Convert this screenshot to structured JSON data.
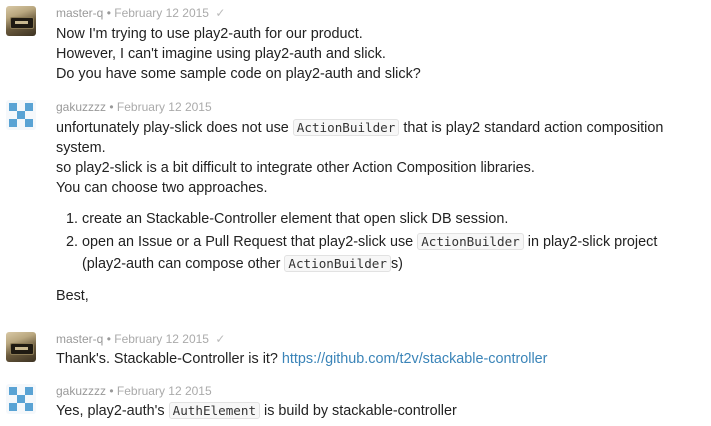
{
  "messages": [
    {
      "author": "master-q",
      "date": "February 12 2015",
      "lines": [
        "Now I'm trying to use play2-auth for our product.",
        "However, I can't imagine using play2-auth and slick.",
        "Do you have some sample code on play2-auth and slick?"
      ]
    },
    {
      "author": "gakuzzzz",
      "date": "February 12 2015",
      "p1_a": "unfortunately play-slick does not use",
      "p1_code": "ActionBuilder",
      "p1_b": "that is play2 standard action composition",
      "p1_c": "system.",
      "p2": "so play2-slick is a bit difficult to integrate other Action Composition libraries.",
      "p3": "You can choose two approaches.",
      "li1": "create an Stackable-Controller element that open slick DB session.",
      "li2_a": "open an Issue or a Pull Request that play2-slick use",
      "li2_code": "ActionBuilder",
      "li2_b": "in play2-slick project",
      "li2_c": "(play2-auth can compose other",
      "li2_code2": "ActionBuilder",
      "li2_d": "s)",
      "closing": "Best,"
    },
    {
      "author": "master-q",
      "date": "February 12 2015",
      "text": "Thank's. Stackable-Controller is it?",
      "link": "https://github.com/t2v/stackable-controller"
    },
    {
      "author": "gakuzzzz",
      "date": "February 12 2015",
      "text_a": "Yes, play2-auth's",
      "code": "AuthElement",
      "text_b": "is build by stackable-controller"
    }
  ],
  "separator": "•",
  "icons": {
    "read": "check-icon",
    "avatar_master": "avatar-master-q",
    "avatar_gaku": "avatar-gakuzzzz"
  },
  "colors": {
    "link": "#3a84b8",
    "meta": "#999999",
    "identicon": "#5aa3d4"
  }
}
